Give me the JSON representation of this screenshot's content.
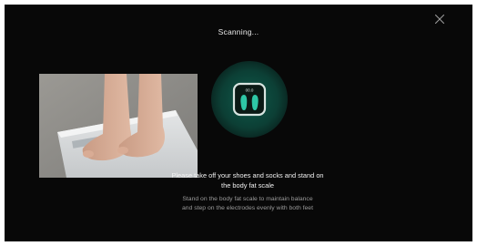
{
  "dialog": {
    "status_text": "Scanning...",
    "close_icon": "close-icon",
    "illustration": "feet-on-scale-photo",
    "scan_icon": "scale-feet-icon",
    "scale_display_text": "00.0",
    "heading": "Please take off your shoes and socks and stand on the body fat scale",
    "description": "Stand on the body fat scale to maintain balance and step on the electrodes evenly with both feet",
    "colors": {
      "background": "#080808",
      "accent": "#2ec7a6",
      "glow": "#0d5446"
    }
  }
}
